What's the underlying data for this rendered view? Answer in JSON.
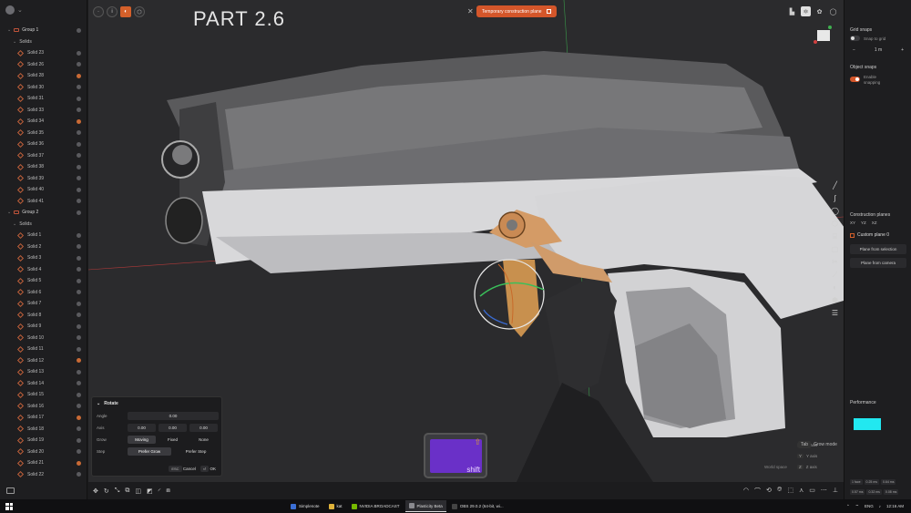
{
  "outliner": {
    "groups": [
      {
        "label": "Group 1",
        "sub": "Solids",
        "items": [
          {
            "label": "Solid 23",
            "marked": false
          },
          {
            "label": "Solid 26",
            "marked": false
          },
          {
            "label": "Solid 28",
            "marked": true
          },
          {
            "label": "Solid 30",
            "marked": false
          },
          {
            "label": "Solid 31",
            "marked": false
          },
          {
            "label": "Solid 33",
            "marked": false
          },
          {
            "label": "Solid 34",
            "marked": true
          },
          {
            "label": "Solid 35",
            "marked": false
          },
          {
            "label": "Solid 36",
            "marked": false
          },
          {
            "label": "Solid 37",
            "marked": false
          },
          {
            "label": "Solid 38",
            "marked": false
          },
          {
            "label": "Solid 39",
            "marked": false
          },
          {
            "label": "Solid 40",
            "marked": false
          },
          {
            "label": "Solid 41",
            "marked": false
          }
        ]
      },
      {
        "label": "Group 2",
        "sub": "Solids",
        "items": [
          {
            "label": "Solid 1",
            "marked": false
          },
          {
            "label": "Solid 2",
            "marked": false
          },
          {
            "label": "Solid 3",
            "marked": false
          },
          {
            "label": "Solid 4",
            "marked": false
          },
          {
            "label": "Solid 5",
            "marked": false
          },
          {
            "label": "Solid 6",
            "marked": false
          },
          {
            "label": "Solid 7",
            "marked": false
          },
          {
            "label": "Solid 8",
            "marked": false
          },
          {
            "label": "Solid 9",
            "marked": false
          },
          {
            "label": "Solid 10",
            "marked": false
          },
          {
            "label": "Solid 11",
            "marked": false
          },
          {
            "label": "Solid 12",
            "marked": true
          },
          {
            "label": "Solid 13",
            "marked": false
          },
          {
            "label": "Solid 14",
            "marked": false
          },
          {
            "label": "Solid 15",
            "marked": false
          },
          {
            "label": "Solid 16",
            "marked": false
          },
          {
            "label": "Solid 17",
            "marked": true
          },
          {
            "label": "Solid 18",
            "marked": false
          },
          {
            "label": "Solid 19",
            "marked": false
          },
          {
            "label": "Solid 20",
            "marked": false
          },
          {
            "label": "Solid 21",
            "marked": true
          },
          {
            "label": "Solid 22",
            "marked": false
          }
        ]
      }
    ]
  },
  "viewport": {
    "title": "PART 2.6",
    "temp_plane_label": "Temporary construction plane"
  },
  "rotate": {
    "title": "Rotate",
    "angle_label": "Angle",
    "angle_value": "0.00",
    "axis_label": "Axis",
    "axis_values": [
      "0.00",
      "0.00",
      "0.00"
    ],
    "grow_label": "Grow",
    "grow_options": [
      "Moving",
      "Fixed",
      "None"
    ],
    "step_label": "Step",
    "step_options": [
      "Prefer Grow",
      "Prefer Step"
    ],
    "esc_key": "ESC",
    "cancel_label": "Cancel",
    "ok_key": "⏎",
    "ok_label": "OK"
  },
  "shift_key": {
    "label": "shift"
  },
  "hints": {
    "x_axis": "X axis",
    "y_axis": "Y axis",
    "z_axis": "Z axis",
    "keys": [
      "X",
      "Y",
      "Z"
    ],
    "world_space": "World space",
    "grow_mode_key": "Tab",
    "grow_mode_label": "Grow mode"
  },
  "right_panel": {
    "grid_snaps_title": "Grid snaps",
    "snap_to_grid": "Snap to grid",
    "stepper_minus": "−",
    "stepper_value": "1 m",
    "stepper_plus": "+",
    "object_snaps_title": "Object snaps",
    "enable_snapping": "Enable snapping",
    "construction_planes_title": "Construction planes",
    "planes": [
      "XY",
      "YZ",
      "XZ"
    ],
    "custom_plane": "Custom plane 0",
    "plane_from_selection": "Plane from selection",
    "plane_from_camera": "Plane from camera",
    "performance_title": "Performance",
    "perf_readout": "144 FPS (15 MB)",
    "face_stats": [
      "1 face",
      "0.25 ms",
      "0.64 ms"
    ],
    "face_stats2": [
      "0.57 ms",
      "0.32 ms",
      "0.08 ms"
    ]
  },
  "taskbar": {
    "apps": [
      {
        "label": "Simplenote",
        "color": "#3b6fd6",
        "active": false
      },
      {
        "label": "kat",
        "color": "#e0b33a",
        "active": false
      },
      {
        "label": "NVIDIA BROADCAST",
        "color": "#76b900",
        "active": false
      },
      {
        "label": "Plasticity Beta",
        "color": "#8a8a8f",
        "active": true
      },
      {
        "label": "OBS 29.0.2 (64-bit, wi...",
        "color": "#444",
        "active": false
      }
    ],
    "lang": "ENG",
    "time": "12:16 AM"
  }
}
